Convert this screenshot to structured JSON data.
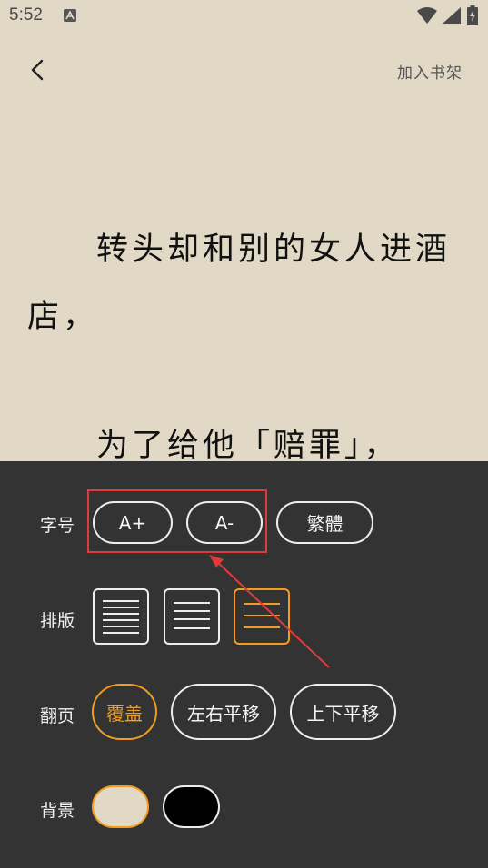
{
  "status_bar": {
    "time": "5:52",
    "icons": [
      "notification-icon",
      "wifi-icon",
      "signal-icon",
      "battery-charging-icon"
    ]
  },
  "app_bar": {
    "back_icon": "chevron-left-icon",
    "add_to_shelf": "加入书架"
  },
  "reading": {
    "paragraphs": [
      "转头却和别的女人进酒店，",
      "为了给他「赔罪」，"
    ]
  },
  "settings": {
    "font_size": {
      "label": "字号",
      "increase": "A+",
      "decrease": "A-",
      "traditional": "繁體"
    },
    "layout": {
      "label": "排版",
      "options": [
        "dense-lines-icon",
        "medium-lines-icon",
        "loose-lines-icon"
      ],
      "selected_index": 2
    },
    "page_turn": {
      "label": "翻页",
      "options": [
        "覆盖",
        "左右平移",
        "上下平移"
      ],
      "selected": "覆盖"
    },
    "background": {
      "label": "背景",
      "options": [
        "#e1d9c5",
        "#000000"
      ],
      "selected_index": 0
    }
  },
  "colors": {
    "page_bg": "#e1d9c5",
    "panel_bg": "#333333",
    "accent": "#f39c1f",
    "annotation": "#e23a3a"
  }
}
